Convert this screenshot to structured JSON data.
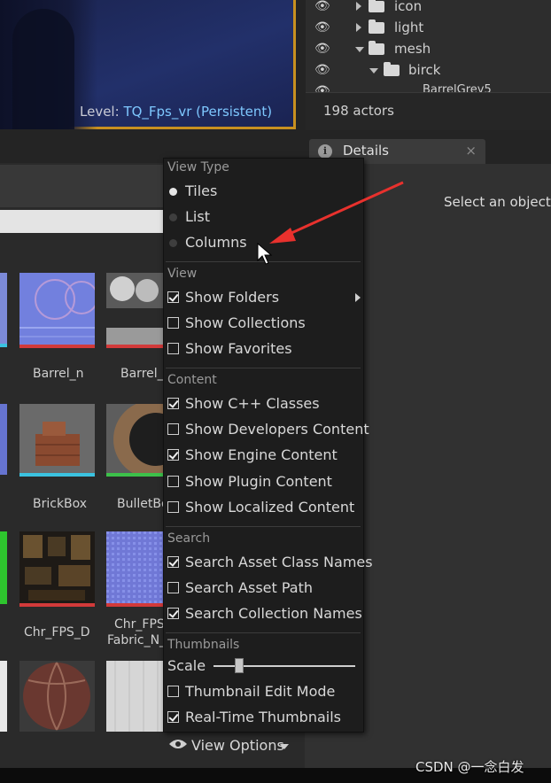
{
  "viewport": {
    "level_prefix": "Level:",
    "level_name": "TQ_Fps_vr (Persistent)"
  },
  "outliner": {
    "items": [
      {
        "label": "icon",
        "expanded": false
      },
      {
        "label": "light",
        "expanded": false
      },
      {
        "label": "mesh",
        "expanded": true
      },
      {
        "label": "birck",
        "expanded": true
      },
      {
        "label": "BarrelGrey5"
      }
    ],
    "actor_count": "198 actors"
  },
  "details": {
    "tab_label": "Details",
    "close": "×",
    "hint": "Select an object t"
  },
  "content_browser": {
    "tiles": [
      {
        "label": "Barrel_n"
      },
      {
        "label": "Barrel_s"
      },
      {
        "label": "BrickBox"
      },
      {
        "label": "BulletBo"
      },
      {
        "label": "Chr_FPS_D"
      },
      {
        "label": "Chr_FPS",
        "label2": "Fabric_N_"
      }
    ]
  },
  "menu": {
    "view_type": {
      "header": "View Type",
      "options": [
        {
          "label": "Tiles",
          "selected": true
        },
        {
          "label": "List",
          "selected": false
        },
        {
          "label": "Columns",
          "selected": false
        }
      ]
    },
    "view": {
      "header": "View",
      "items": [
        {
          "label": "Show Folders",
          "checked": true,
          "submenu": true
        },
        {
          "label": "Show Collections",
          "checked": false
        },
        {
          "label": "Show Favorites",
          "checked": false
        }
      ]
    },
    "content": {
      "header": "Content",
      "items": [
        {
          "label": "Show C++ Classes",
          "checked": true
        },
        {
          "label": "Show Developers Content",
          "checked": false
        },
        {
          "label": "Show Engine Content",
          "checked": true
        },
        {
          "label": "Show Plugin Content",
          "checked": false
        },
        {
          "label": "Show Localized Content",
          "checked": false
        }
      ]
    },
    "search": {
      "header": "Search",
      "items": [
        {
          "label": "Search Asset Class Names",
          "checked": true
        },
        {
          "label": "Search Asset Path",
          "checked": false
        },
        {
          "label": "Search Collection Names",
          "checked": true
        }
      ]
    },
    "thumbnails": {
      "header": "Thumbnails",
      "scale_label": "Scale",
      "scale_value": 0.2,
      "items": [
        {
          "label": "Thumbnail Edit Mode",
          "checked": false
        },
        {
          "label": "Real-Time Thumbnails",
          "checked": true
        }
      ]
    }
  },
  "view_options": {
    "label": "View Options"
  },
  "watermark": "CSDN @一念白发",
  "colors": {
    "accent_arrow": "#e8312d",
    "level_link": "#7ec8ff",
    "viewport_border": "#c89020"
  }
}
